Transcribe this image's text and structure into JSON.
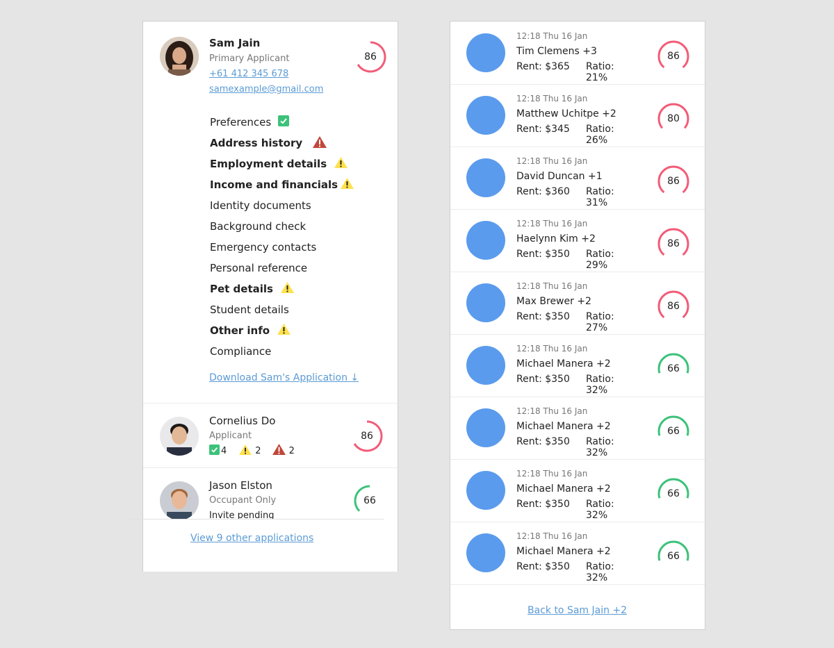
{
  "colors": {
    "red_gauge": "#f25c78",
    "green_gauge": "#3cc27a",
    "link": "#5b9bd5",
    "avatar_blue": "#5b9bed",
    "check_green": "#3cc27a",
    "warn_yellow": "#ffe14d",
    "warn_red": "#c0473a"
  },
  "primary": {
    "name": "Sam Jain",
    "role": "Primary Applicant",
    "phone": "+61 412 345 678",
    "email": "samexample@gmail.com",
    "score": "86",
    "sections": [
      {
        "label": "Preferences",
        "bold": false,
        "icon": "check-icon"
      },
      {
        "label": "Address history",
        "bold": true,
        "icon": "error-warning-icon"
      },
      {
        "label": "Employment details",
        "bold": true,
        "icon": "warning-icon"
      },
      {
        "label": "Income and financials",
        "bold": true,
        "icon": "warning-icon"
      },
      {
        "label": "Identity documents",
        "bold": false,
        "icon": ""
      },
      {
        "label": "Background check",
        "bold": false,
        "icon": ""
      },
      {
        "label": "Emergency contacts",
        "bold": false,
        "icon": ""
      },
      {
        "label": "Personal reference",
        "bold": false,
        "icon": ""
      },
      {
        "label": "Pet details",
        "bold": true,
        "icon": "warning-icon"
      },
      {
        "label": "Student details",
        "bold": false,
        "icon": ""
      },
      {
        "label": "Other info",
        "bold": true,
        "icon": "warning-icon"
      },
      {
        "label": "Compliance",
        "bold": false,
        "icon": ""
      }
    ],
    "download_label": "Download Sam's Application"
  },
  "co_applicant": {
    "name": "Cornelius Do",
    "role": "Applicant",
    "score": "86",
    "check_count": "4",
    "warn_count": "2",
    "error_count": "2"
  },
  "occupant": {
    "name": "Jason Elston",
    "role": "Occupant Only",
    "status": "Invite pending",
    "score": "66"
  },
  "view_more_label": "View 9 other applications",
  "applications": [
    {
      "time": "12:18 Thu 16 Jan",
      "name": "Tim Clemens +3",
      "rent": "Rent: $365",
      "ratio": "Ratio: 21%",
      "score": "86",
      "color": "red"
    },
    {
      "time": "12:18 Thu 16 Jan",
      "name": "Matthew Uchitpe +2",
      "rent": "Rent: $345",
      "ratio": "Ratio: 26%",
      "score": "80",
      "color": "red"
    },
    {
      "time": "12:18 Thu 16 Jan",
      "name": "David Duncan +1",
      "rent": "Rent: $360",
      "ratio": "Ratio: 31%",
      "score": "86",
      "color": "red"
    },
    {
      "time": "12:18 Thu 16 Jan",
      "name": "Haelynn Kim +2",
      "rent": "Rent: $350",
      "ratio": "Ratio: 29%",
      "score": "86",
      "color": "red"
    },
    {
      "time": "12:18 Thu 16 Jan",
      "name": "Max Brewer +2",
      "rent": "Rent: $350",
      "ratio": "Ratio: 27%",
      "score": "86",
      "color": "red"
    },
    {
      "time": "12:18 Thu 16 Jan",
      "name": "Michael Manera +2",
      "rent": "Rent: $350",
      "ratio": "Ratio: 32%",
      "score": "66",
      "color": "green"
    },
    {
      "time": "12:18 Thu 16 Jan",
      "name": "Michael Manera +2",
      "rent": "Rent: $350",
      "ratio": "Ratio: 32%",
      "score": "66",
      "color": "green"
    },
    {
      "time": "12:18 Thu 16 Jan",
      "name": "Michael Manera +2",
      "rent": "Rent: $350",
      "ratio": "Ratio: 32%",
      "score": "66",
      "color": "green"
    },
    {
      "time": "12:18 Thu 16 Jan",
      "name": "Michael Manera +2",
      "rent": "Rent: $350",
      "ratio": "Ratio: 32%",
      "score": "66",
      "color": "green"
    }
  ],
  "back_label": "Back to Sam Jain +2"
}
